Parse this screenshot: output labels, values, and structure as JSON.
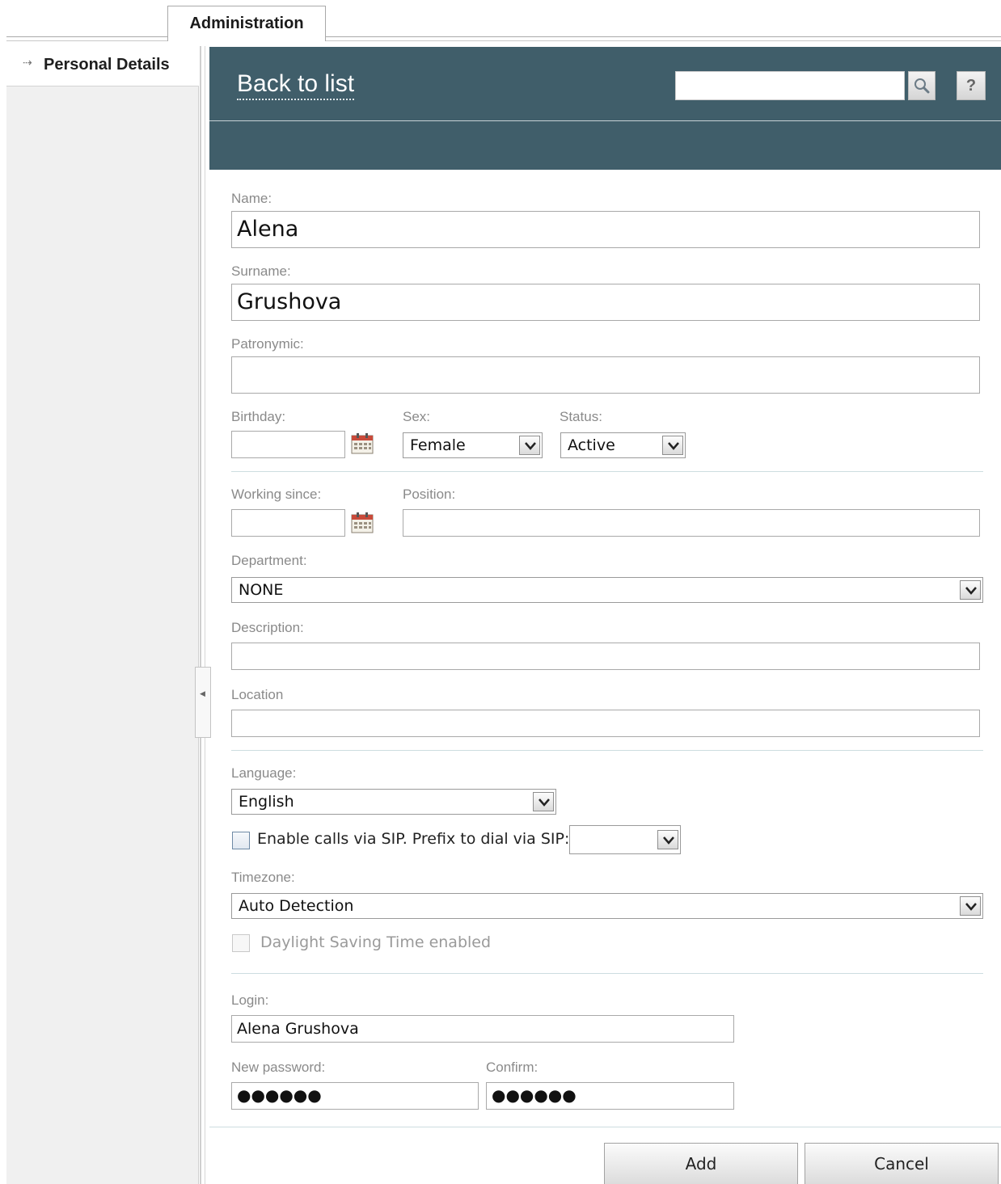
{
  "tab": {
    "label": "Administration"
  },
  "sidebar": {
    "items": [
      {
        "label": "Personal Details",
        "arrow": "⇢"
      }
    ]
  },
  "header": {
    "back_label": "Back to list",
    "search_value": "",
    "help_label": "?"
  },
  "form": {
    "name": {
      "label": "Name:",
      "value": "Alena"
    },
    "surname": {
      "label": "Surname:",
      "value": "Grushova"
    },
    "patronymic": {
      "label": "Patronymic:",
      "value": ""
    },
    "birthday": {
      "label": "Birthday:",
      "value": ""
    },
    "sex": {
      "label": "Sex:",
      "value": "Female"
    },
    "status": {
      "label": "Status:",
      "value": "Active"
    },
    "working_since": {
      "label": "Working since:",
      "value": ""
    },
    "position": {
      "label": "Position:",
      "value": ""
    },
    "department": {
      "label": "Department:",
      "value": "NONE"
    },
    "description": {
      "label": "Description:",
      "value": ""
    },
    "location": {
      "label": "Location",
      "value": ""
    },
    "language": {
      "label": "Language:",
      "value": "English"
    },
    "sip": {
      "label": "Enable calls via SIP. Prefix to dial via SIP:",
      "checked": false,
      "prefix_value": ""
    },
    "timezone": {
      "label": "Timezone:",
      "value": "Auto Detection"
    },
    "dst": {
      "label": "Daylight Saving Time enabled",
      "checked": false,
      "disabled": true
    },
    "login": {
      "label": "Login:",
      "value": "Alena Grushova"
    },
    "new_password": {
      "label": "New password:",
      "value": "●●●●●●"
    },
    "confirm": {
      "label": "Confirm:",
      "value": "●●●●●●"
    }
  },
  "buttons": {
    "add": "Add",
    "cancel": "Cancel"
  },
  "colors": {
    "header_bg": "#405e6a",
    "label_gray": "#8a8a8a"
  },
  "icons": [
    "arrow-right-icon",
    "search-icon",
    "help-icon",
    "calendar-icon",
    "chevron-down-icon",
    "collapse-left-icon"
  ]
}
